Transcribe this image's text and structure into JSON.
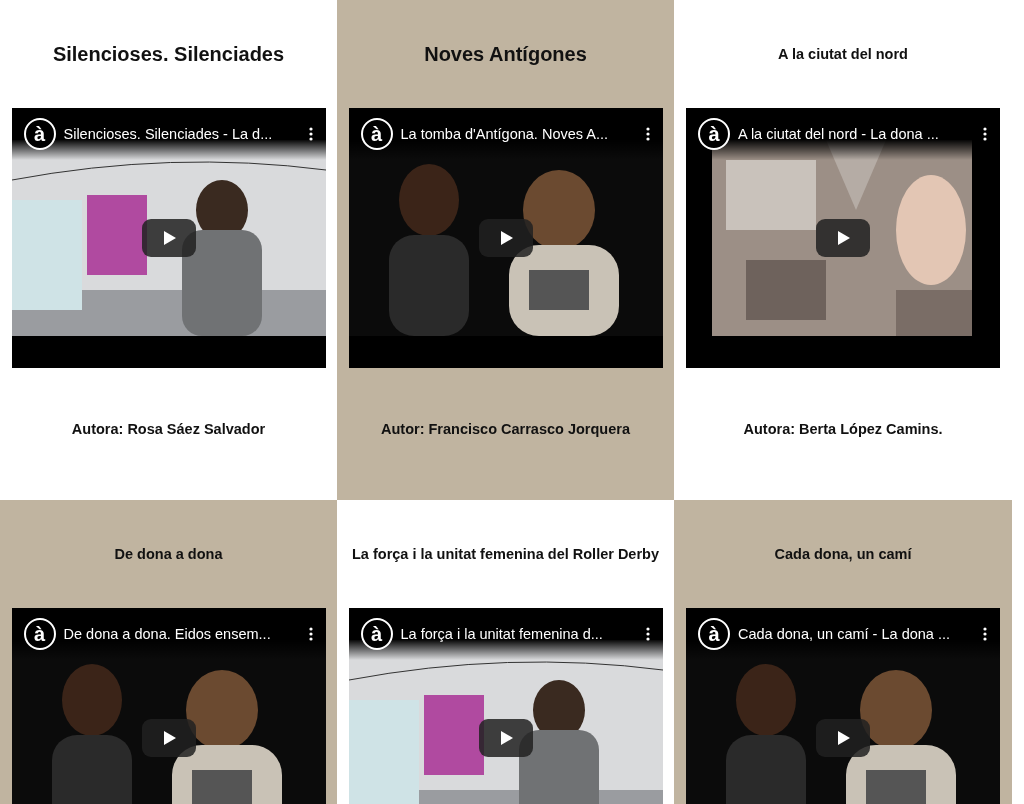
{
  "cells": [
    {
      "color": "#ffffff",
      "title": "Silencioses. Silenciades",
      "kind": "large",
      "video": {
        "logo": "à",
        "title": "Silencioses. Silenciades - La d..."
      },
      "author": "Autora: Rosa Sáez Salvador"
    },
    {
      "color": "#c0b4a0",
      "title": "Noves Antígones",
      "kind": "large",
      "video": {
        "logo": "à",
        "title": "La tomba d'Antígona. Noves A..."
      },
      "author": "Autor: Francisco Carrasco Jorquera"
    },
    {
      "color": "#ffffff",
      "title": "A la ciutat del nord",
      "kind": "small",
      "video": {
        "logo": "à",
        "title": "A la ciutat del nord - La dona ...",
        "kind": "painting"
      },
      "author": "Autora: Berta López Camins."
    },
    {
      "color": "#c0b4a0",
      "title": "De dona a dona",
      "kind": "small",
      "video": {
        "logo": "à",
        "title": "De dona a dona. Eidos ensem..."
      }
    },
    {
      "color": "#ffffff",
      "title": "La força i la unitat femenina del Roller Derby",
      "kind": "small",
      "video": {
        "logo": "à",
        "title": "La força i la unitat femenina d..."
      }
    },
    {
      "color": "#c0b4a0",
      "title": "Cada dona, un camí",
      "kind": "small",
      "video": {
        "logo": "à",
        "title": "Cada dona, un camí - La dona ..."
      }
    }
  ]
}
